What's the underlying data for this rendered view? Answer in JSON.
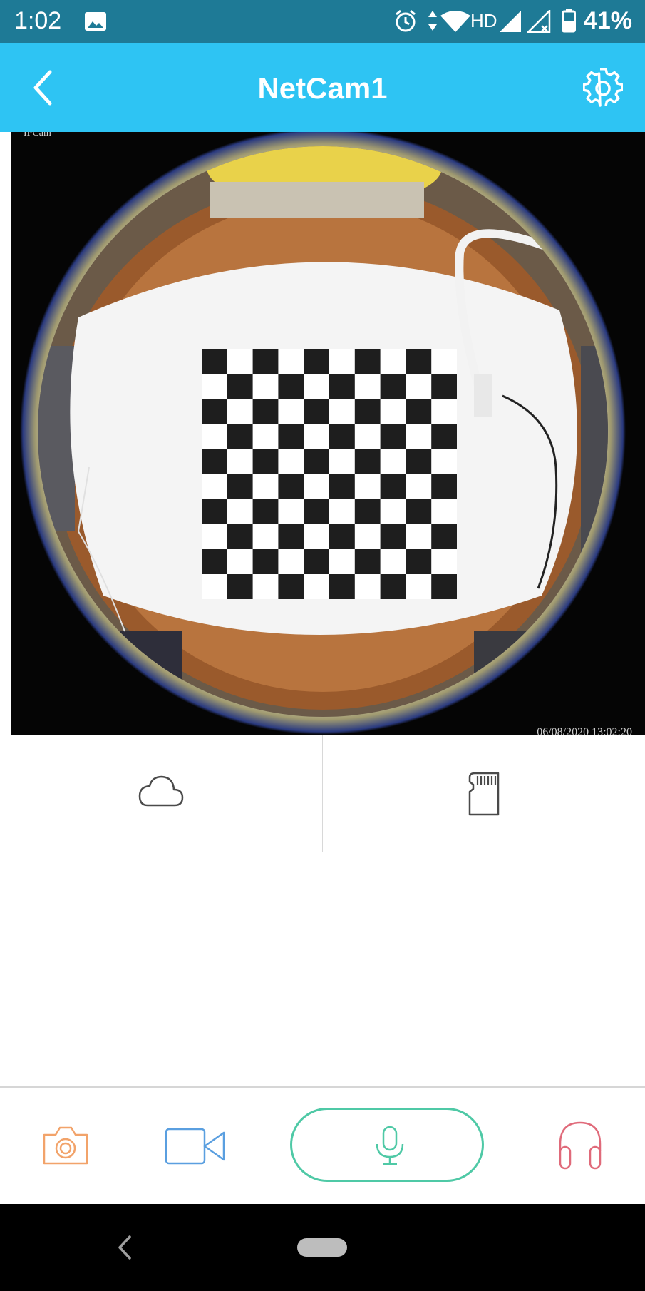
{
  "status_bar": {
    "time": "1:02",
    "network": "HD",
    "battery": "41%"
  },
  "app_bar": {
    "title": "NetCam1"
  },
  "video": {
    "camera_name_overlay": "IPCam",
    "timestamp_overlay": "06/08/2020 13:02:20"
  },
  "colors": {
    "status_bar": "#1e7a96",
    "app_bar": "#2ec4f3",
    "snapshot": "#f2a36a",
    "record": "#5a9fe0",
    "talk": "#4fc9a6",
    "listen": "#e06a7a"
  },
  "icons": {
    "storage": [
      "cloud-icon",
      "sd-card-icon"
    ],
    "toolbar": [
      "camera-icon",
      "video-camera-icon",
      "microphone-icon",
      "headphones-icon"
    ]
  }
}
